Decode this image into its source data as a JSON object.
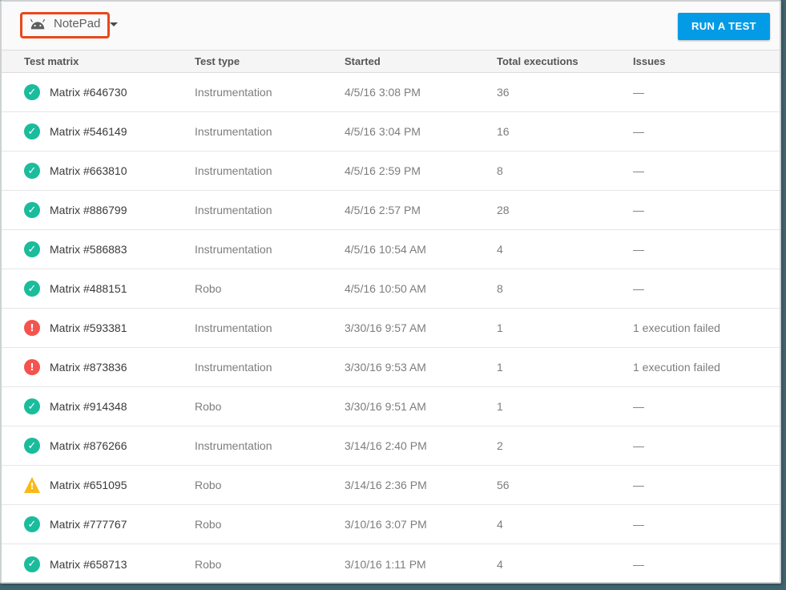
{
  "toolbar": {
    "app_selector": {
      "label": "NotePad"
    },
    "run_test_label": "RUN A TEST"
  },
  "table": {
    "columns": [
      "Test matrix",
      "Test type",
      "Started",
      "Total executions",
      "Issues"
    ],
    "rows": [
      {
        "status": "success",
        "name": "Matrix #646730",
        "type": "Instrumentation",
        "started": "4/5/16 3:08 PM",
        "executions": "36",
        "issues": "—"
      },
      {
        "status": "success",
        "name": "Matrix #546149",
        "type": "Instrumentation",
        "started": "4/5/16 3:04 PM",
        "executions": "16",
        "issues": "—"
      },
      {
        "status": "success",
        "name": "Matrix #663810",
        "type": "Instrumentation",
        "started": "4/5/16 2:59 PM",
        "executions": "8",
        "issues": "—"
      },
      {
        "status": "success",
        "name": "Matrix #886799",
        "type": "Instrumentation",
        "started": "4/5/16 2:57 PM",
        "executions": "28",
        "issues": "—"
      },
      {
        "status": "success",
        "name": "Matrix #586883",
        "type": "Instrumentation",
        "started": "4/5/16 10:54 AM",
        "executions": "4",
        "issues": "—"
      },
      {
        "status": "success",
        "name": "Matrix #488151",
        "type": "Robo",
        "started": "4/5/16 10:50 AM",
        "executions": "8",
        "issues": "—"
      },
      {
        "status": "error",
        "name": "Matrix #593381",
        "type": "Instrumentation",
        "started": "3/30/16 9:57 AM",
        "executions": "1",
        "issues": "1 execution failed"
      },
      {
        "status": "error",
        "name": "Matrix #873836",
        "type": "Instrumentation",
        "started": "3/30/16 9:53 AM",
        "executions": "1",
        "issues": "1 execution failed"
      },
      {
        "status": "success",
        "name": "Matrix #914348",
        "type": "Robo",
        "started": "3/30/16 9:51 AM",
        "executions": "1",
        "issues": "—"
      },
      {
        "status": "success",
        "name": "Matrix #876266",
        "type": "Instrumentation",
        "started": "3/14/16 2:40 PM",
        "executions": "2",
        "issues": "—"
      },
      {
        "status": "warning",
        "name": "Matrix #651095",
        "type": "Robo",
        "started": "3/14/16 2:36 PM",
        "executions": "56",
        "issues": "—"
      },
      {
        "status": "success",
        "name": "Matrix #777767",
        "type": "Robo",
        "started": "3/10/16 3:07 PM",
        "executions": "4",
        "issues": "—"
      },
      {
        "status": "success",
        "name": "Matrix #658713",
        "type": "Robo",
        "started": "3/10/16 1:11 PM",
        "executions": "4",
        "issues": "—"
      }
    ]
  },
  "icons": {
    "success": "✓",
    "error": "!",
    "warning": "!"
  },
  "colors": {
    "success": "#1ABC9C",
    "error": "#F4534E",
    "warning": "#F9B916",
    "run_button": "#039BE5",
    "annotation": "#E8481C",
    "frame": "#3F6470"
  }
}
